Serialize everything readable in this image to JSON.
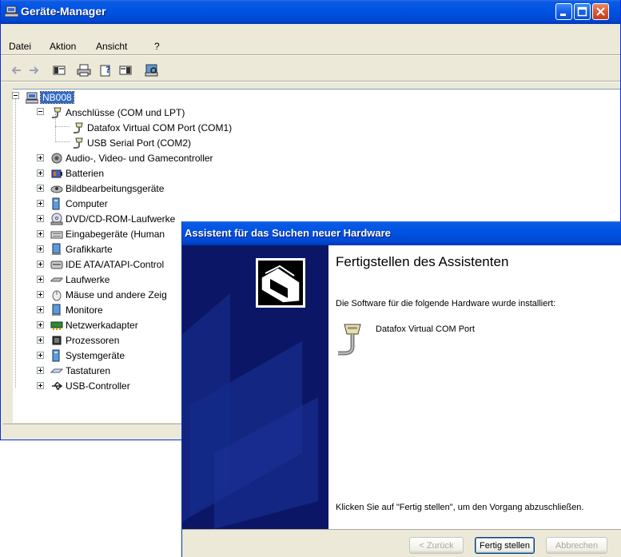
{
  "device_manager": {
    "title": "Geräte-Manager",
    "menu": [
      "Datei",
      "Aktion",
      "Ansicht",
      "?"
    ],
    "toolbar_icons": [
      "back-arrow-icon",
      "forward-arrow-icon",
      "properties-view-icon",
      "print-icon",
      "help-properties-icon",
      "driver-icon",
      "scan-hardware-icon"
    ],
    "tree": {
      "root": "NB008",
      "expanded": {
        "label": "Anschlüsse (COM und LPT)",
        "children": [
          "Datafox Virtual COM Port (COM1)",
          "USB Serial Port (COM2)"
        ]
      },
      "categories": [
        "Audio-, Video- und Gamecontroller",
        "Batterien",
        "Bildbearbeitungsgeräte",
        "Computer",
        "DVD/CD-ROM-Laufwerke",
        "Eingabegeräte (Human",
        "Grafikkarte",
        "IDE ATA/ATAPI-Control",
        "Laufwerke",
        "Mäuse und andere Zeig",
        "Monitore",
        "Netzwerkadapter",
        "Prozessoren",
        "Systemgeräte",
        "Tastaturen",
        "USB-Controller"
      ]
    }
  },
  "wizard": {
    "title": "Assistent für das Suchen neuer Hardware",
    "heading": "Fertigstellen des Assistenten",
    "installed_text": "Die Software für die folgende Hardware wurde installiert:",
    "device_name": "Datafox Virtual COM Port",
    "finish_text": "Klicken Sie auf \"Fertig stellen\", um den Vorgang abzuschließen.",
    "buttons": {
      "back": "< Zurück",
      "finish": "Fertig stellen",
      "cancel": "Abbrechen"
    }
  }
}
